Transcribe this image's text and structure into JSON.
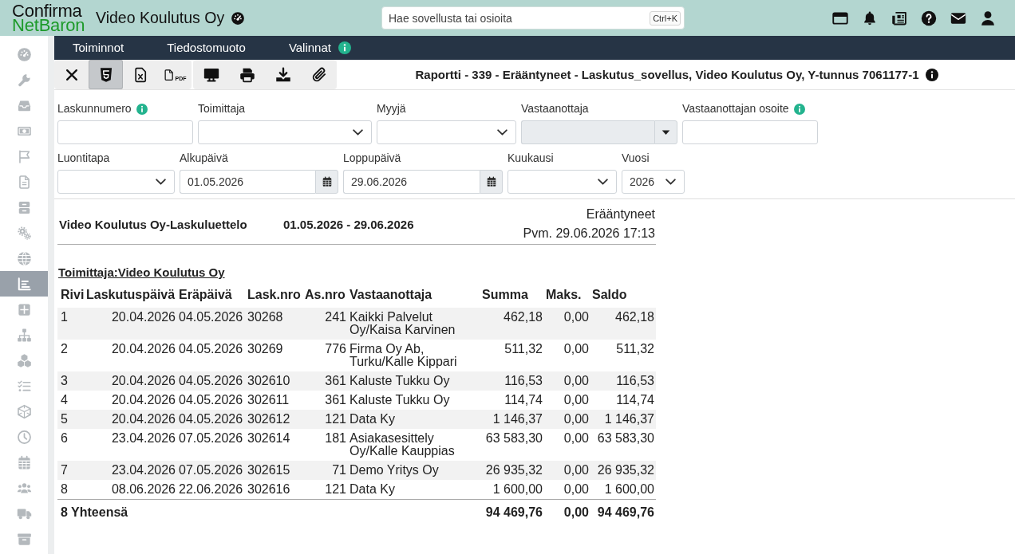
{
  "header": {
    "logo": [
      "Confirma",
      "NetBaron"
    ],
    "company": "Video Koulutus Oy",
    "search": {
      "placeholder": "Hae sovellusta tai osioita",
      "shortcut": "Ctrl+K"
    }
  },
  "sidebar": {
    "items": [
      {
        "selected": false
      },
      {
        "selected": false
      },
      {
        "selected": false
      },
      {
        "selected": false
      },
      {
        "selected": false
      },
      {
        "selected": false
      },
      {
        "selected": false
      },
      {
        "selected": false
      },
      {
        "selected": false
      },
      {
        "selected": true
      },
      {
        "selected": false
      },
      {
        "selected": false
      },
      {
        "selected": false
      },
      {
        "selected": false
      },
      {
        "selected": false
      },
      {
        "selected": false
      },
      {
        "selected": false
      },
      {
        "selected": false
      },
      {
        "selected": false
      },
      {
        "selected": false
      }
    ]
  },
  "menu": [
    {
      "label": "Toiminnot",
      "info": false
    },
    {
      "label": "Tiedostomuoto",
      "info": false
    },
    {
      "label": "Valinnat",
      "info": true
    }
  ],
  "toolbar": {
    "buttons": [
      {
        "kind": "close",
        "selected": false
      },
      {
        "kind": "html",
        "selected": true
      },
      {
        "kind": "excel",
        "selected": false
      },
      {
        "kind": "pdf",
        "caption": "PDF",
        "selected": false
      },
      {
        "kind": "screen",
        "selected": false
      },
      {
        "kind": "print",
        "selected": false
      },
      {
        "kind": "download",
        "selected": false
      },
      {
        "kind": "attach",
        "selected": false
      }
    ],
    "title": "Raportti - 339 - Erääntyneet - Laskutus_sovellus, Video Koulutus Oy, Y-tunnus 7061177-1",
    "info": true
  },
  "filters": [
    {
      "fields": [
        {
          "label": "Laskunnumero",
          "kind": "text",
          "info": true,
          "disabled": false
        },
        {
          "label": "Toimittaja",
          "kind": "select",
          "info": false,
          "disabled": false
        },
        {
          "label": "Myyjä",
          "kind": "select",
          "info": false,
          "disabled": false
        },
        {
          "label": "Vastaanottaja",
          "kind": "combo",
          "info": false,
          "disabled": true
        },
        {
          "label": "Vastaanottajan osoite",
          "kind": "text",
          "info": true,
          "disabled": false
        }
      ]
    },
    {
      "fields": [
        {
          "label": "Luontitapa",
          "kind": "select",
          "info": false,
          "disabled": false
        },
        {
          "label": "Alkupäivä",
          "kind": "date",
          "value": "01.05.2026",
          "info": false,
          "disabled": false
        },
        {
          "label": "Loppupäivä",
          "kind": "date",
          "value": "29.06.2026",
          "info": false,
          "disabled": false
        },
        {
          "label": "Kuukausi",
          "kind": "select",
          "info": false,
          "disabled": false
        },
        {
          "label": "Vuosi",
          "kind": "select",
          "value": "2026",
          "info": false,
          "disabled": false
        }
      ]
    }
  ],
  "report": {
    "title": "Video Koulutus Oy-Laskuluettelo",
    "period": "01.05.2026 - 29.06.2026",
    "status": "Erääntyneet",
    "printed": "Pvm. 29.06.2026 17:13",
    "group": "Toimittaja:Video Koulutus Oy",
    "table": {
      "columns": [
        "Rivi",
        "Laskutuspäivä",
        "Eräpäivä",
        "Lask.nro",
        "As.nro",
        "Vastaanottaja",
        "Summa",
        "Maks.",
        "Saldo"
      ],
      "rows": [
        [
          "1",
          "20.04.2026",
          "04.05.2026",
          "30268",
          "241",
          "Kaikki Palvelut Oy/Kaisa Karvinen",
          "462,18",
          "0,00",
          "462,18"
        ],
        [
          "2",
          "20.04.2026",
          "04.05.2026",
          "30269",
          "776",
          "Firma Oy Ab, Turku/Kalle Kippari",
          "511,32",
          "0,00",
          "511,32"
        ],
        [
          "3",
          "20.04.2026",
          "04.05.2026",
          "302610",
          "361",
          "Kaluste Tukku Oy",
          "116,53",
          "0,00",
          "116,53"
        ],
        [
          "4",
          "20.04.2026",
          "04.05.2026",
          "302611",
          "361",
          "Kaluste Tukku Oy",
          "114,74",
          "0,00",
          "114,74"
        ],
        [
          "5",
          "20.04.2026",
          "04.05.2026",
          "302612",
          "121",
          "Data Ky",
          "1 146,37",
          "0,00",
          "1 146,37"
        ],
        [
          "6",
          "23.04.2026",
          "07.05.2026",
          "302614",
          "181",
          "Asiakasesittely Oy/Kalle Kauppias",
          "63 583,30",
          "0,00",
          "63 583,30"
        ],
        [
          "7",
          "23.04.2026",
          "07.05.2026",
          "302615",
          "71",
          "Demo Yritys Oy",
          "26 935,32",
          "0,00",
          "26 935,32"
        ],
        [
          "8",
          "08.06.2026",
          "22.06.2026",
          "302616",
          "121",
          "Data Ky",
          "1 600,00",
          "0,00",
          "1 600,00"
        ]
      ],
      "total": {
        "label": "8 Yhteensä",
        "values": [
          "94 469,76",
          "0,00",
          "94 469,76"
        ]
      }
    }
  }
}
